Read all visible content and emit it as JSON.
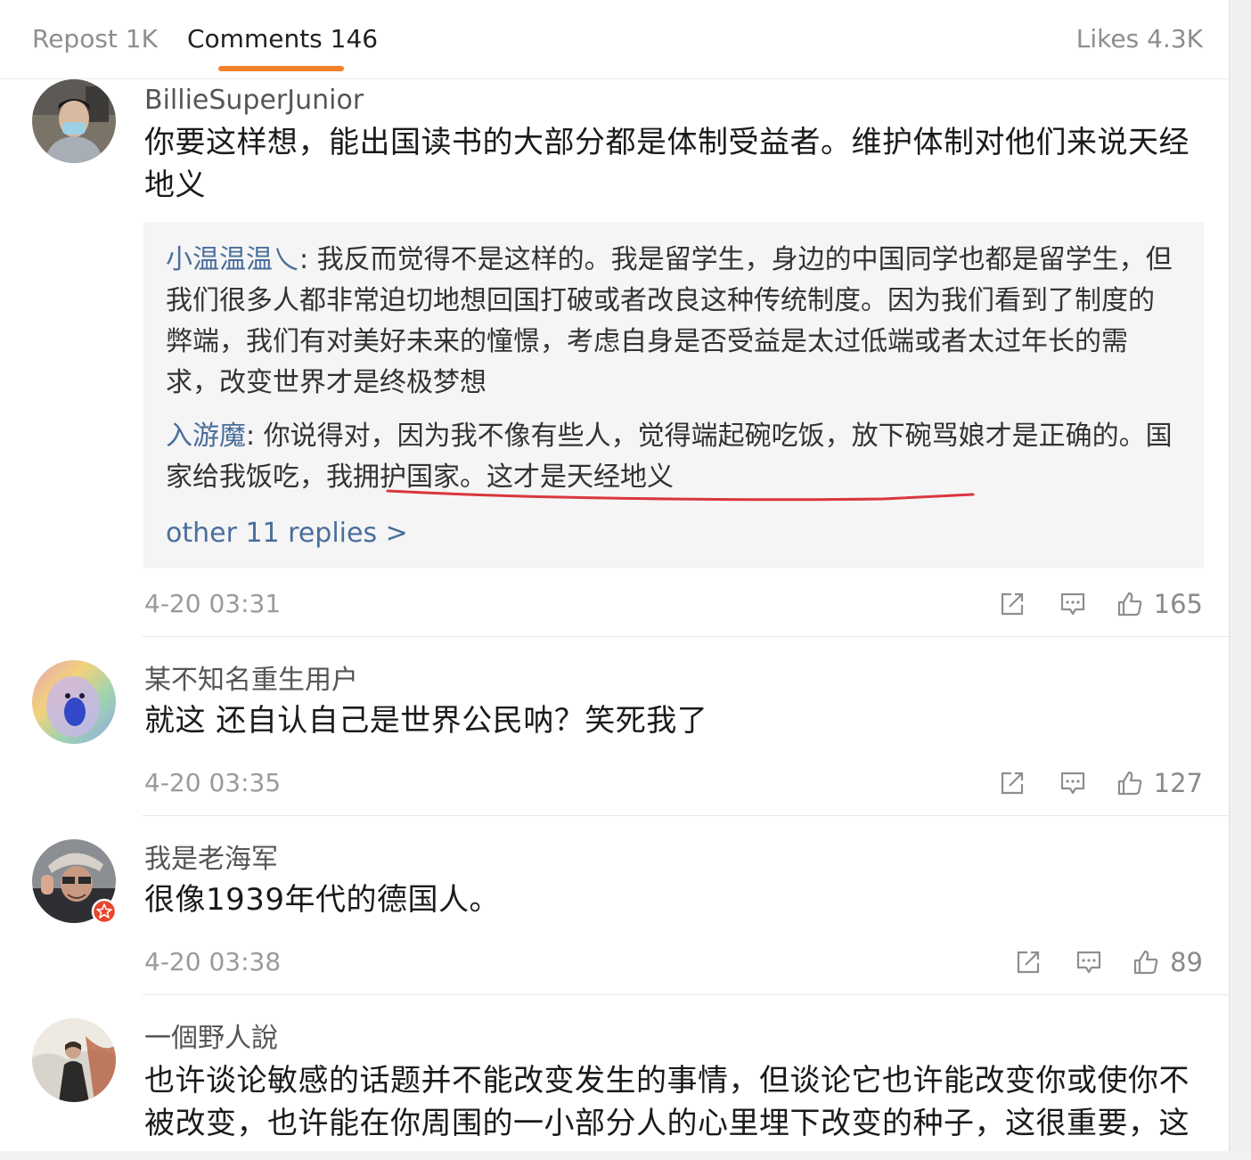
{
  "tabs": {
    "repost": "Repost 1K",
    "comments": "Comments 146",
    "likes": "Likes 4.3K",
    "active_color": "#f3812b"
  },
  "comments": [
    {
      "username": "BillieSuperJunior",
      "text": "你要这样想，能出国读书的大部分都是体制受益者。维护体制对他们来说天经地义",
      "replies": [
        {
          "user": "小温温温乀",
          "sep": ": ",
          "text": "我反而觉得不是这样的。我是留学生，身边的中国同学也都是留学生，但我们很多人都非常迫切地想回国打破或者改良这种传统制度。因为我们看到了制度的弊端，我们有对美好未来的憧憬，考虑自身是否受益是太过低端或者太过年长的需求，改变世界才是终极梦想"
        },
        {
          "user": "入游魔",
          "sep": ": ",
          "text": "你说得对，因为我不像有些人，觉得端起碗吃饭，放下碗骂娘才是正确的。国家给我饭吃，我拥护国家。这才是天经地义"
        }
      ],
      "more_replies": "other 11 replies >",
      "time": "4-20 03:31",
      "likes": "165"
    },
    {
      "username": "某不知名重生用户",
      "text": "就这 还自认自己是世界公民呐？笑死我了",
      "time": "4-20 03:35",
      "likes": "127"
    },
    {
      "username": "我是老海军",
      "text": "很像1939年代的德国人。",
      "time": "4-20 03:38",
      "likes": "89"
    },
    {
      "username": "一個野人說",
      "text": "也许谈论敏感的话题并不能改变发生的事情，但谈论它也许能改变你或使你不被改变，也许能在你周围的一小部分人的心里埋下改变的种子，这很重要，这"
    }
  ],
  "icons": [
    "share-icon",
    "comment-icon",
    "like-icon"
  ],
  "colors": {
    "link": "#4a6e9c",
    "muted": "#9a9a9a",
    "annotation": "#d9363e"
  }
}
